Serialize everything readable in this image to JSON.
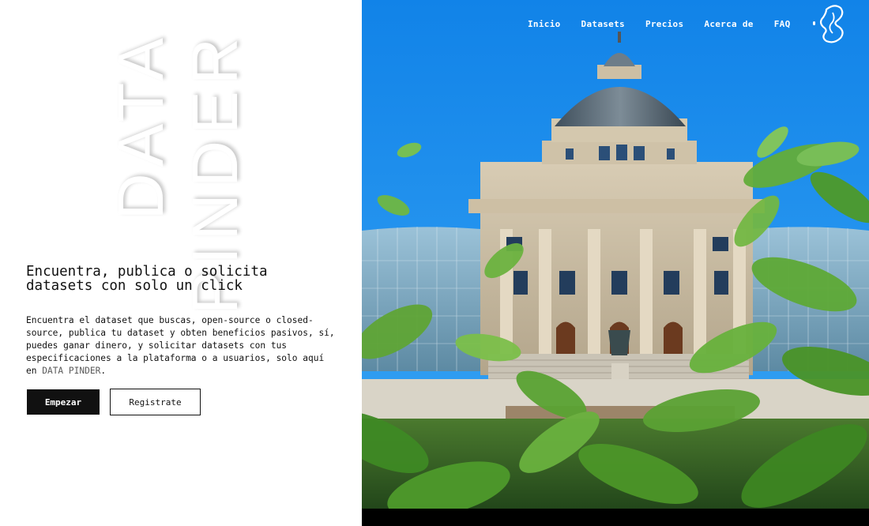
{
  "brand": {
    "bg_word_1": "DATA",
    "bg_word_2": "PINDER",
    "logo_icon": "dp-logo-icon"
  },
  "nav": {
    "items": [
      "Inicio",
      "Datasets",
      "Precios",
      "Acerca de",
      "FAQ"
    ]
  },
  "hero": {
    "headline": "Encuentra, publica o solicita datasets con solo un click",
    "description": "Encuentra el dataset que buscas, open-source o closed-source, publica tu dataset y obten beneficios pasivos, sí, puedes ganar dinero, y solicitar datasets con tus especificaciones a la plataforma o a usuarios, solo aquí en ",
    "description_brand": "DATA PINDER",
    "description_end": ".",
    "cta_primary": "Empezar",
    "cta_secondary": "Registrate"
  },
  "colors": {
    "sky": "#1a8ff0",
    "primary_button": "#111111",
    "text": "#111111"
  }
}
